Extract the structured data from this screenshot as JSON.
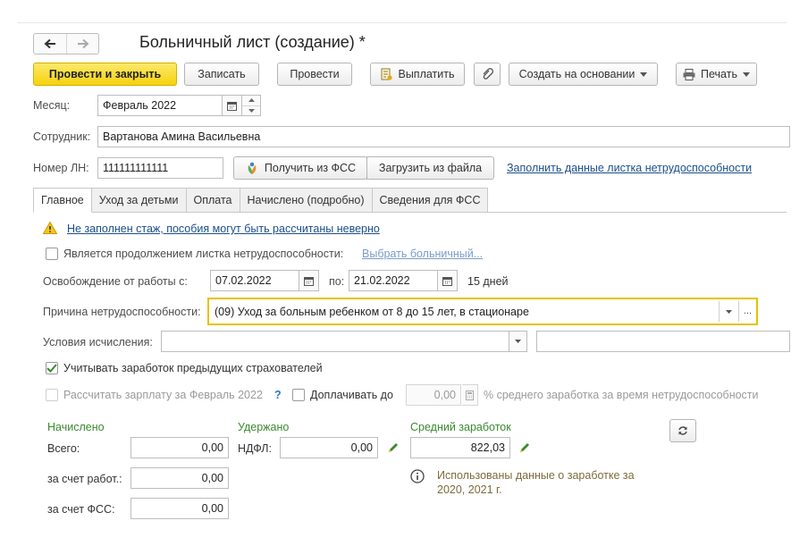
{
  "window": {
    "title": "Больничный лист (создание) *"
  },
  "icons": {
    "back": "arrow-left-icon",
    "forward": "arrow-right-icon",
    "pay": "document-icon",
    "attach": "paperclip-icon",
    "print": "printer-icon",
    "calendar": "calendar-icon",
    "fss": "fss-logo-icon",
    "warning": "warning-icon",
    "info": "info-icon",
    "edit": "pencil-icon",
    "refresh": "refresh-icon"
  },
  "toolbar": {
    "post_close": "Провести и закрыть",
    "save": "Записать",
    "post": "Провести",
    "pay": "Выплатить",
    "create_based": "Создать на основании",
    "print": "Печать"
  },
  "header": {
    "month_label": "Месяц:",
    "month_value": "Февраль 2022",
    "employee_label": "Сотрудник:",
    "employee_value": "Вартанова Амина Васильевна",
    "ln_label": "Номер ЛН:",
    "ln_value": "111111111111",
    "get_from_fss": "Получить из ФСС",
    "load_from_file": "Загрузить из файла",
    "fill_link": "Заполнить данные листка нетрудоспособности"
  },
  "tabs": [
    "Главное",
    "Уход за детьми",
    "Оплата",
    "Начислено (подробно)",
    "Сведения для ФСС"
  ],
  "main": {
    "warning_text": "Не заполнен стаж, пособия могут быть рассчитаны неверно",
    "continuation_label": "Является продолжением листка нетрудоспособности:",
    "continuation_checked": false,
    "select_sick_link": "Выбрать больничный...",
    "release_from_label": "Освобождение от работы с:",
    "release_from_value": "07.02.2022",
    "to_label": "по:",
    "to_value": "21.02.2022",
    "days_text": "15 дней",
    "reason_label": "Причина нетрудоспособности:",
    "reason_value": "(09) Уход за больным ребенком от 8 до 15 лет, в стационаре",
    "conditions_label": "Условия исчисления:",
    "conditions_value": "",
    "account_prev_label": "Учитывать заработок предыдущих страхователей",
    "account_prev_checked": true,
    "recalc_label": "Рассчитать зарплату за Февраль 2022",
    "recalc_help": "?",
    "recalc_checked": false,
    "topup_label": "Доплачивать до",
    "topup_checked": false,
    "topup_value": "0,00",
    "topup_suffix": "% среднего заработка за время нетрудоспособности"
  },
  "totals": {
    "accrued_title": "Начислено",
    "total_label": "Всего:",
    "total_value": "0,00",
    "employer_label": "за счет работ.:",
    "employer_value": "0,00",
    "fss_label": "за счет ФСС:",
    "fss_value": "0,00",
    "withheld_title": "Удержано",
    "ndfl_label": "НДФЛ:",
    "ndfl_value": "0,00",
    "avg_title": "Средний заработок",
    "avg_value": "822,03",
    "info_line1": "Использованы данные о заработке за",
    "info_line2": "2020,  2021 г."
  },
  "colors": {
    "primary_button": "#f6d20e",
    "link": "#1b4f8a",
    "section_title": "#3a8a2e",
    "focus_border": "#e6c200",
    "info_text": "#7d6b39",
    "checkbox_mark": "#3a8a2e"
  }
}
